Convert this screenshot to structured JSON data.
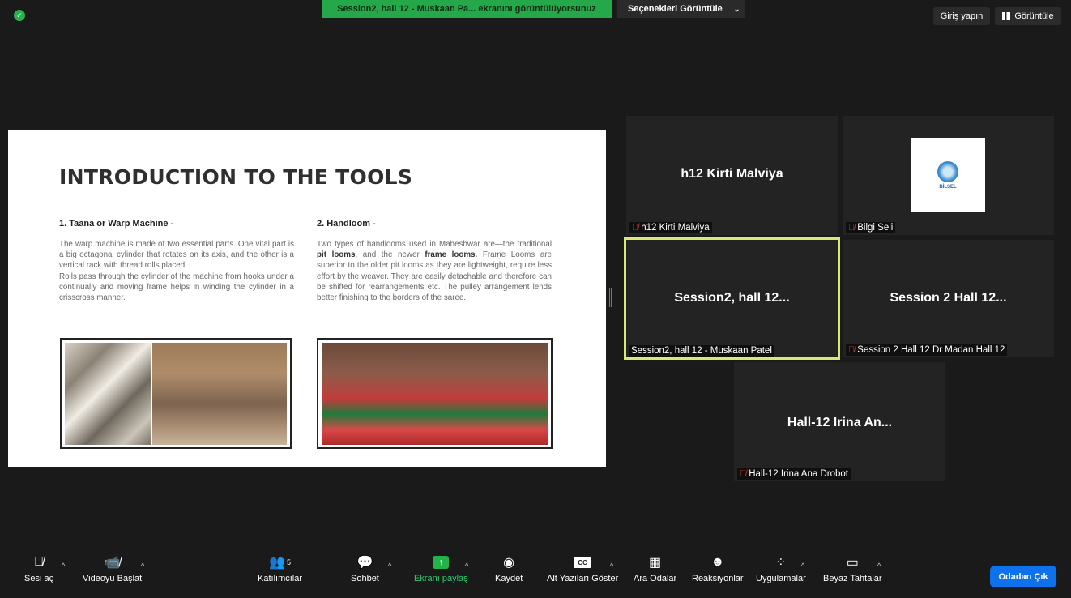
{
  "topbar": {
    "share_banner": "Session2, hall 12 - Muskaan Pa... ekranını görüntülüyorsunuz",
    "view_options": "Seçenekleri Görüntüle",
    "signin": "Giriş yapın",
    "view": "Görüntüle"
  },
  "slide": {
    "title": "INTRODUCTION TO THE TOOLS",
    "col1_heading": "1. Taana or Warp Machine -",
    "col1_text_1": "The warp machine is made of two essential parts. One vital part is a big octagonal cylinder that rotates on its axis, and the other is a vertical rack with thread rolls placed.",
    "col1_text_2": "Rolls pass through the cylinder of the machine from hooks under a continually and moving frame helps in winding the cylinder in a crisscross manner.",
    "col2_heading": "2. Handloom -",
    "col2_text_a": "Two types of handlooms used in Maheshwar are—the traditional ",
    "col2_bold_1": "pit looms",
    "col2_text_b": ", and the newer ",
    "col2_bold_2": "frame looms.",
    "col2_text_c": " Frame Looms are superior to the older pit looms as they are lightweight, require less effort by the weaver. They are easily detachable and therefore can be shifted for rearrangements etc. The pulley arrangement lends better finishing to the borders of the saree."
  },
  "tiles": [
    {
      "center": "h12 Kirti Malviya",
      "name": "h12 Kirti Malviya"
    },
    {
      "center": "",
      "name": "Bilgi Seli"
    },
    {
      "center": "Session2, hall 12...",
      "name": "Session2, hall 12 - Muskaan Patel"
    },
    {
      "center": "Session 2 Hall 12...",
      "name": "Session 2 Hall 12 Dr Madan Hall 12"
    },
    {
      "center": "Hall-12 Irina An...",
      "name": "Hall-12 Irina Ana Drobot"
    }
  ],
  "logo_text": "BİLSEL",
  "toolbar": {
    "audio": "Sesi aç",
    "video": "Videoyu Başlat",
    "participants": "Katılımcılar",
    "participants_count": "5",
    "chat": "Sohbet",
    "share": "Ekranı paylaş",
    "record": "Kaydet",
    "captions": "Alt Yazıları Göster",
    "cc": "CC",
    "breakout": "Ara Odalar",
    "reactions": "Reaksiyonlar",
    "apps": "Uygulamalar",
    "whiteboards": "Beyaz Tahtalar",
    "leave": "Odadan Çık"
  }
}
